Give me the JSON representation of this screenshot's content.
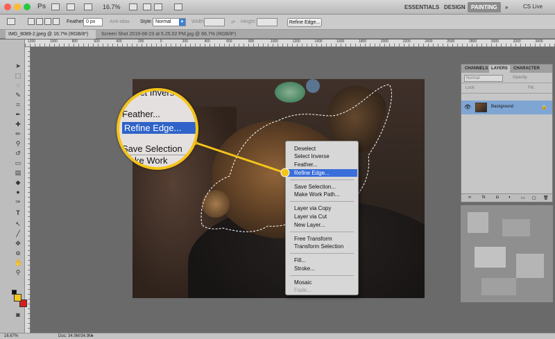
{
  "app": {
    "logo": "Ps",
    "zoom": "16.7%",
    "workspaces": [
      "ESSENTIALS",
      "DESIGN",
      "PAINTING"
    ],
    "active_workspace": "PAINTING",
    "more": "»",
    "cs_live": "CS Live"
  },
  "options_bar": {
    "feather_label": "Feather:",
    "feather_value": "0 px",
    "antialias_label": "Anti-alias",
    "style_label": "Style:",
    "style_value": "Normal",
    "width_label": "Width:",
    "height_label": "Height:",
    "refine_edge_button": "Refine Edge..."
  },
  "tabs": [
    {
      "label": "IMG_8089-2.jpeg @ 16.7% (RGB/8*)",
      "active": true
    },
    {
      "label": "Screen Shot 2019-08-23 at 5.25.02 PM.jpg @ 66.7% (RGB/8*)",
      "active": false
    }
  ],
  "ruler_numbers": [
    "1200",
    "1000",
    "800",
    "600",
    "400",
    "200",
    "0",
    "200",
    "400",
    "600",
    "800",
    "1000",
    "1200",
    "1400",
    "1600",
    "1800",
    "2000",
    "2200",
    "2400",
    "2600",
    "2800",
    "3000",
    "3200",
    "3400"
  ],
  "context_menu": {
    "items": [
      "Deselect",
      "Select Inverse",
      "Feather...",
      "Refine Edge...",
      "Save Selection...",
      "Make Work Path...",
      "Layer via Copy",
      "Layer via Cut",
      "New Layer...",
      "Free Transform",
      "Transform Selection",
      "Fill...",
      "Stroke...",
      "Mosaic",
      "Fade..."
    ],
    "highlighted": "Refine Edge...",
    "disabled": [
      "Fade..."
    ]
  },
  "magnifier": {
    "items": [
      "Select Inverse",
      "Feather...",
      "Refine Edge...",
      "Save Selection",
      "Make Work"
    ]
  },
  "panel": {
    "tabs": [
      "CHANNELS",
      "LAYERS",
      "CHARACTER"
    ],
    "active_tab": "LAYERS",
    "blend_mode": "Normal",
    "opacity_label": "Opacity:",
    "lock_label": "Lock:",
    "fill_label": "Fill:",
    "layer_name": "Background"
  },
  "status": {
    "zoom": "16.67%",
    "doc": "Doc: 34.9M/34.9M"
  },
  "colors": {
    "highlight": "#3a6ed9",
    "magnifier_ring": "#f4c41a",
    "foreground_swatch": "#f4c41a",
    "background_swatch": "#d81e1e"
  }
}
